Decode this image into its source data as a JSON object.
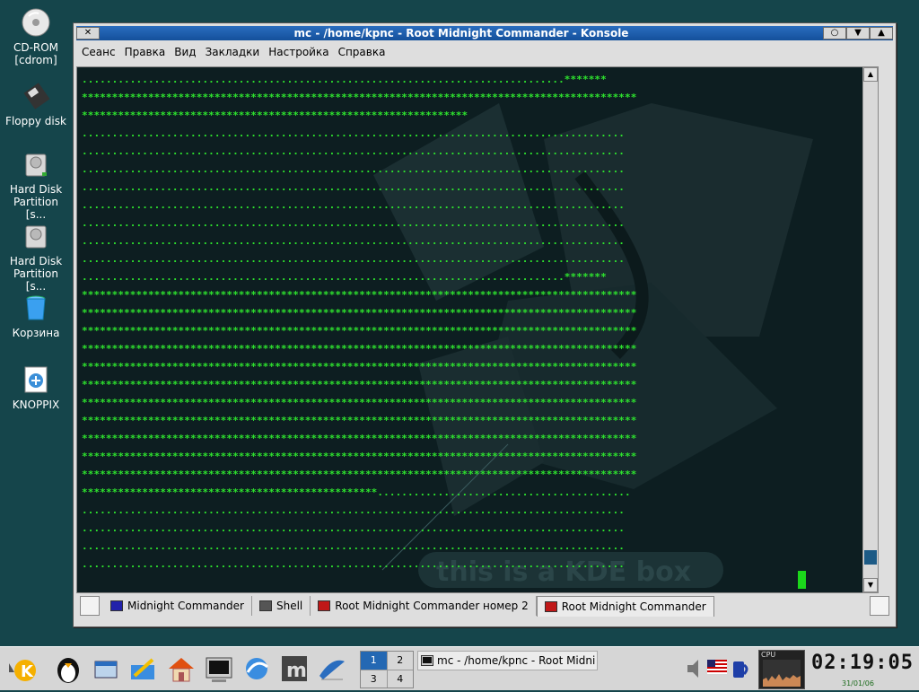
{
  "desktop_icons": [
    {
      "label": "CD-ROM\n[cdrom]",
      "icon": "cdrom-icon"
    },
    {
      "label": "Floppy disk",
      "icon": "floppy-icon"
    },
    {
      "label": "Hard Disk\nPartition [s...",
      "icon": "harddisk-icon"
    },
    {
      "label": "Hard Disk\nPartition [s...",
      "icon": "harddisk-icon"
    },
    {
      "label": "Корзина",
      "icon": "trash-icon"
    },
    {
      "label": "KNOPPIX",
      "icon": "knoppix-icon"
    }
  ],
  "window": {
    "title": "mc - /home/kpnc - Root Midnight Commander - Konsole",
    "menu": [
      "Сеанс",
      "Правка",
      "Вид",
      "Закладки",
      "Настройка",
      "Справка"
    ],
    "terminal_lines": [
      "................................................................................*******",
      "********************************************************************************************",
      "****************************************************************",
      "..........................................................................................",
      "..........................................................................................",
      "..........................................................................................",
      "..........................................................................................",
      "..........................................................................................",
      "..........................................................................................",
      "..........................................................................................",
      "..........................................................................................",
      "................................................................................*******",
      "********************************************************************************************",
      "********************************************************************************************",
      "********************************************************************************************",
      "********************************************************************************************",
      "********************************************************************************************",
      "********************************************************************************************",
      "********************************************************************************************",
      "********************************************************************************************",
      "********************************************************************************************",
      "********************************************************************************************",
      "********************************************************************************************",
      "*************************************************..........................................",
      "..........................................................................................",
      "..........................................................................................",
      "..........................................................................................",
      ".........................................................................................."
    ],
    "watermark": "this is a KDE box",
    "tabs": [
      {
        "label": "Midnight Commander",
        "color": "#2222aa"
      },
      {
        "label": "Shell",
        "color": "#555555"
      },
      {
        "label": "Root Midnight Commander номер 2",
        "color": "#c01818"
      },
      {
        "label": "Root Midnight Commander",
        "color": "#c01818",
        "active": true
      }
    ]
  },
  "taskbar": {
    "pager": [
      "1",
      "2",
      "3",
      "4"
    ],
    "active_desktop": "1",
    "task_label": "mc - /home/kpnc - Root Midni",
    "cpu_label": "CPU",
    "clock": "02:19:05",
    "date": "31/01/06"
  }
}
